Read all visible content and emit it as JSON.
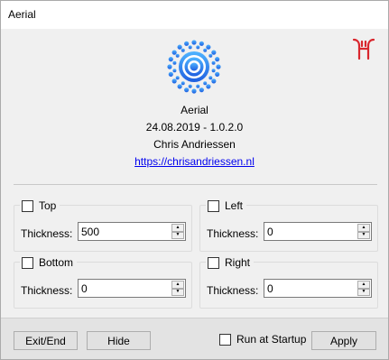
{
  "window": {
    "title": "Aerial"
  },
  "about": {
    "app_name": "Aerial",
    "version_line": "24.08.2019 - 1.0.2.0",
    "author": "Chris Andriessen",
    "url": "https://chrisandriessen.nl"
  },
  "groups": {
    "top": {
      "label": "Top",
      "checked": false,
      "field_label": "Thickness:",
      "value": "500"
    },
    "left": {
      "label": "Left",
      "checked": false,
      "field_label": "Thickness:",
      "value": "0"
    },
    "bottom": {
      "label": "Bottom",
      "checked": false,
      "field_label": "Thickness:",
      "value": "0"
    },
    "right": {
      "label": "Right",
      "checked": false,
      "field_label": "Thickness:",
      "value": "0"
    }
  },
  "footer": {
    "exit_label": "Exit/End",
    "hide_label": "Hide",
    "run_at_startup_label": "Run at Startup",
    "run_at_startup_checked": false,
    "apply_label": "Apply"
  },
  "icons": {
    "app_icon": "concentric-rings-icon",
    "corner_logo": "aerial-logo-icon",
    "spin_up": "spin-up-icon",
    "spin_down": "spin-down-icon"
  },
  "colors": {
    "app_icon_blue": "#2b7bf0",
    "corner_logo_red": "#d9262d",
    "link": "#0000ee"
  }
}
